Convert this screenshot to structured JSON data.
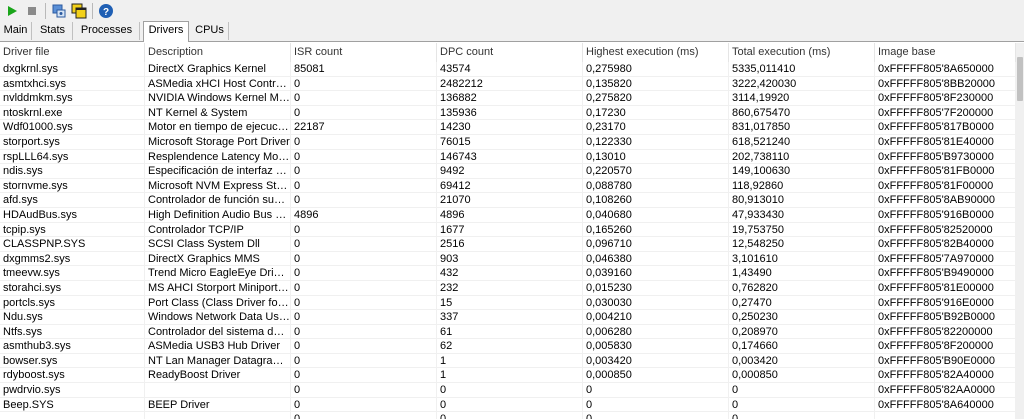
{
  "toolbar": {
    "buttons": [
      {
        "name": "start-button",
        "icon": "play-icon",
        "color": "#1aa51a"
      },
      {
        "name": "stop-button",
        "icon": "stop-icon",
        "color": "#8a8a8a"
      },
      {
        "name": "drivers-view-button",
        "icon": "drivers-icon"
      },
      {
        "name": "window-button",
        "icon": "window-icon"
      },
      {
        "name": "help-button",
        "icon": "help-icon",
        "color": "#1f5fb4"
      }
    ]
  },
  "tabs": [
    {
      "label": "Main",
      "underline": "M"
    },
    {
      "label": "Stats"
    },
    {
      "label": "Processes"
    },
    {
      "label": "Drivers",
      "active": true
    },
    {
      "label": "CPUs"
    }
  ],
  "table": {
    "columns": [
      "Driver file",
      "Description",
      "ISR count",
      "DPC count",
      "Highest execution (ms)",
      "Total execution (ms)",
      "Image base"
    ],
    "rows": [
      [
        "dxgkrnl.sys",
        "DirectX Graphics Kernel",
        "85081",
        "43574",
        "0,275980",
        "5335,011410",
        "0xFFFFF805'8A650000"
      ],
      [
        "asmtxhci.sys",
        "ASMedia xHCI Host Controller Driver",
        "0",
        "2482212",
        "0,135820",
        "3222,420030",
        "0xFFFFF805'8BB20000"
      ],
      [
        "nvlddmkm.sys",
        "NVIDIA Windows Kernel Mode Driver",
        "0",
        "136882",
        "0,275820",
        "3114,19920",
        "0xFFFFF805'8F230000"
      ],
      [
        "ntoskrnl.exe",
        "NT Kernel & System",
        "0",
        "135936",
        "0,17230",
        "860,675470",
        "0xFFFFF805'7F200000"
      ],
      [
        "Wdf01000.sys",
        "Motor en tiempo de ejecución",
        "22187",
        "14230",
        "0,23170",
        "831,017850",
        "0xFFFFF805'817B0000"
      ],
      [
        "storport.sys",
        "Microsoft Storage Port Driver",
        "0",
        "76015",
        "0,122330",
        "618,521240",
        "0xFFFFF805'81E40000"
      ],
      [
        "rspLLL64.sys",
        "Resplendence Latency Monitoring",
        "0",
        "146743",
        "0,13010",
        "202,738110",
        "0xFFFFF805'B9730000"
      ],
      [
        "ndis.sys",
        "Especificación de interfaz de red",
        "0",
        "9492",
        "0,220570",
        "149,100630",
        "0xFFFFF805'81FB0000"
      ],
      [
        "stornvme.sys",
        "Microsoft NVM Express Storport",
        "0",
        "69412",
        "0,088780",
        "118,92860",
        "0xFFFFF805'81F00000"
      ],
      [
        "afd.sys",
        "Controlador de función suplementaria",
        "0",
        "21070",
        "0,108260",
        "80,913010",
        "0xFFFFF805'8AB90000"
      ],
      [
        "HDAudBus.sys",
        "High Definition Audio Bus Driver",
        "4896",
        "4896",
        "0,040680",
        "47,933430",
        "0xFFFFF805'916B0000"
      ],
      [
        "tcpip.sys",
        "Controlador TCP/IP",
        "0",
        "1677",
        "0,165260",
        "19,753750",
        "0xFFFFF805'82520000"
      ],
      [
        "CLASSPNP.SYS",
        "SCSI Class System Dll",
        "0",
        "2516",
        "0,096710",
        "12,548250",
        "0xFFFFF805'82B40000"
      ],
      [
        "dxgmms2.sys",
        "DirectX Graphics MMS",
        "0",
        "903",
        "0,046380",
        "3,101610",
        "0xFFFFF805'7A970000"
      ],
      [
        "tmeevw.sys",
        "Trend Micro EagleEye Driver (VW)",
        "0",
        "432",
        "0,039160",
        "1,43490",
        "0xFFFFF805'B9490000"
      ],
      [
        "storahci.sys",
        "MS AHCI Storport Miniport Driver",
        "0",
        "232",
        "0,015230",
        "0,762820",
        "0xFFFFF805'81E00000"
      ],
      [
        "portcls.sys",
        "Port Class (Class Driver for Port)",
        "0",
        "15",
        "0,030030",
        "0,27470",
        "0xFFFFF805'916E0000"
      ],
      [
        "Ndu.sys",
        "Windows Network Data Usage",
        "0",
        "337",
        "0,004210",
        "0,250230",
        "0xFFFFF805'B92B0000"
      ],
      [
        "Ntfs.sys",
        "Controlador del sistema de archivos",
        "0",
        "61",
        "0,006280",
        "0,208970",
        "0xFFFFF805'82200000"
      ],
      [
        "asmthub3.sys",
        "ASMedia USB3 Hub Driver",
        "0",
        "62",
        "0,005830",
        "0,174660",
        "0xFFFFF805'8F200000"
      ],
      [
        "bowser.sys",
        "NT Lan Manager Datagram Receiver",
        "0",
        "1",
        "0,003420",
        "0,003420",
        "0xFFFFF805'B90E0000"
      ],
      [
        "rdyboost.sys",
        "ReadyBoost Driver",
        "0",
        "1",
        "0,000850",
        "0,000850",
        "0xFFFFF805'82A40000"
      ],
      [
        "pwdrvio.sys",
        "",
        "0",
        "0",
        "0",
        "0",
        "0xFFFFF805'82AA0000"
      ],
      [
        "Beep.SYS",
        "BEEP Driver",
        "0",
        "0",
        "0",
        "0",
        "0xFFFFF805'8A640000"
      ],
      [
        "",
        "",
        "0",
        "0",
        "0",
        "0",
        ""
      ]
    ]
  }
}
